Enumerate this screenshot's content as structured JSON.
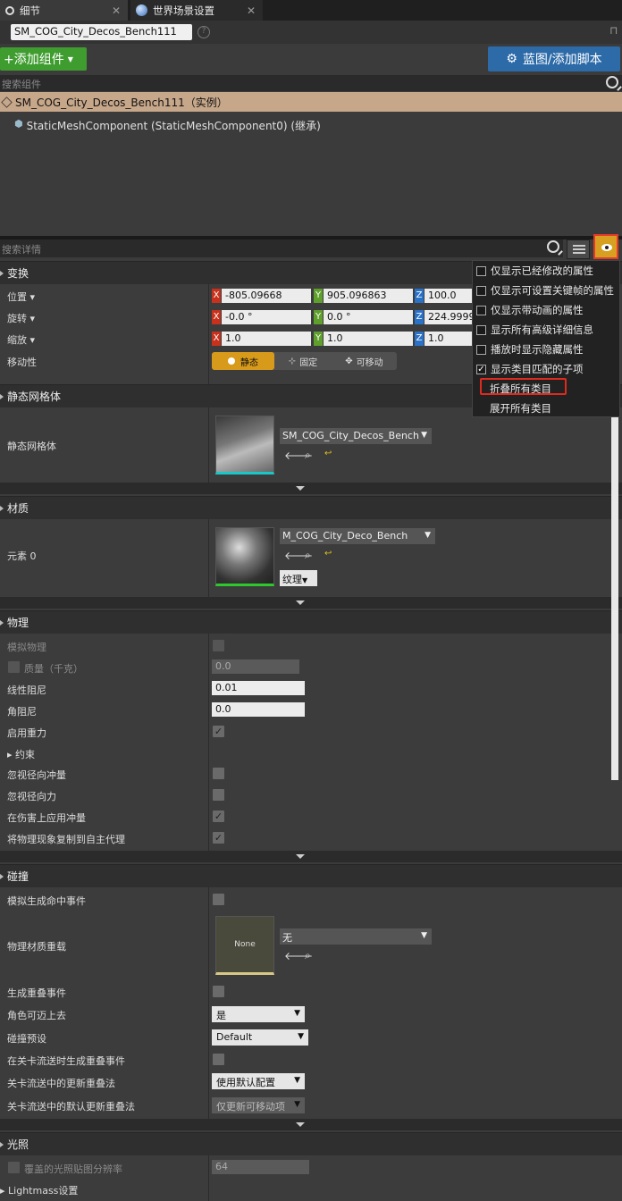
{
  "tabs": [
    {
      "label": "细节",
      "icon": "magnifier-icon"
    },
    {
      "label": "世界场景设置",
      "icon": "globe-icon"
    }
  ],
  "actor_name": "SM_COG_City_Decos_Bench111",
  "add_component_label": "+添加组件",
  "blueprint_button_label": "蓝图/添加脚本",
  "search_components_placeholder": "搜索组件",
  "components": [
    {
      "label": "SM_COG_City_Decos_Bench111（实例）"
    },
    {
      "label": "StaticMeshComponent (StaticMeshComponent0) (继承)"
    }
  ],
  "search_details_placeholder": "搜索详情",
  "transform": {
    "title": "变换",
    "location": {
      "label": "位置",
      "x": "-805.09668",
      "y": "905.096863",
      "z": "100.0"
    },
    "rotation": {
      "label": "旋转",
      "x": "-0.0 °",
      "y": "0.0 °",
      "z": "224.9999"
    },
    "scale": {
      "label": "缩放",
      "x": "1.0",
      "y": "1.0",
      "z": "1.0"
    },
    "mobility": {
      "label": "移动性",
      "options": [
        "静态",
        "固定",
        "可移动"
      ],
      "selected": "静态"
    }
  },
  "axes": {
    "x": "X",
    "y": "Y",
    "z": "Z"
  },
  "static_mesh": {
    "title": "静态网格体",
    "label": "静态网格体",
    "asset": "SM_COG_City_Decos_Bench"
  },
  "materials": {
    "title": "材质",
    "label": "元素 0",
    "asset": "M_COG_City_Deco_Bench",
    "texture_button": "纹理"
  },
  "physics": {
    "title": "物理",
    "simulate": {
      "label": "模拟物理",
      "checked": false
    },
    "mass": {
      "label": "质量（千克）",
      "value": "0.0"
    },
    "linear_damping": {
      "label": "线性阻尼",
      "value": "0.01"
    },
    "angular_damping": {
      "label": "角阻尼",
      "value": "0.0"
    },
    "gravity": {
      "label": "启用重力",
      "checked": true
    },
    "constraints": {
      "label": "约束"
    },
    "ignore_radial_impulse": {
      "label": "忽视径向冲量",
      "checked": false
    },
    "ignore_radial_force": {
      "label": "忽视径向力",
      "checked": false
    },
    "apply_impulse_damage": {
      "label": "在伤害上应用冲量",
      "checked": true
    },
    "replicate_physics": {
      "label": "将物理现象复制到自主代理",
      "checked": true
    }
  },
  "collision": {
    "title": "碰撞",
    "sim_hit_events": {
      "label": "模拟生成命中事件",
      "checked": false
    },
    "phys_material": {
      "label": "物理材质重载",
      "asset": "无",
      "thumb": "None"
    },
    "overlap_events": {
      "label": "生成重叠事件",
      "checked": false
    },
    "step_up": {
      "label": "角色可迈上去",
      "value": "是"
    },
    "preset": {
      "label": "碰撞预设",
      "value": "Default"
    },
    "level_stream_overlap": {
      "label": "在关卡流送时生成重叠事件",
      "checked": false
    },
    "update_overlap_method": {
      "label": "关卡流送中的更新重叠法",
      "value": "使用默认配置"
    },
    "default_update_overlap": {
      "label": "关卡流送中的默认更新重叠法",
      "value": "仅更新可移动项"
    }
  },
  "lighting": {
    "title": "光照",
    "override_lightmap_res": {
      "label": "覆盖的光照贴图分辨率",
      "value": "64"
    },
    "lightmass": {
      "label": "Lightmass设置"
    }
  },
  "view_options_menu": {
    "items": [
      {
        "label": "仅显示已经修改的属性",
        "checked": false
      },
      {
        "label": "仅显示可设置关键帧的属性",
        "checked": false
      },
      {
        "label": "仅显示带动画的属性",
        "checked": false
      },
      {
        "label": "显示所有高级详细信息",
        "checked": false
      },
      {
        "label": "播放时显示隐藏属性",
        "checked": false
      },
      {
        "label": "显示类目匹配的子项",
        "checked": true
      }
    ],
    "collapse_all": "折叠所有类目",
    "expand_all": "展开所有类目"
  }
}
